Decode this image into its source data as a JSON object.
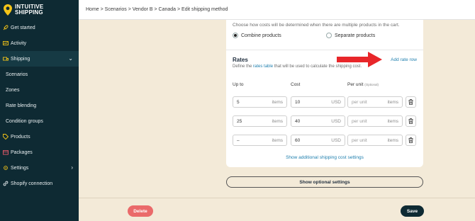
{
  "app": {
    "brand_line1": "INTUITIVE",
    "brand_line2": "SHIPPING"
  },
  "sidebar": {
    "items": [
      {
        "label": "Get started",
        "icon": "rocket-icon"
      },
      {
        "label": "Activity",
        "icon": "activity-icon"
      },
      {
        "label": "Shipping",
        "icon": "shipping-icon"
      },
      {
        "label": "Scenarios"
      },
      {
        "label": "Zones"
      },
      {
        "label": "Rate blending"
      },
      {
        "label": "Condition groups"
      },
      {
        "label": "Products",
        "icon": "tag-icon"
      },
      {
        "label": "Packages",
        "icon": "package-icon"
      },
      {
        "label": "Settings",
        "icon": "gear-icon"
      },
      {
        "label": "Shopify connection",
        "icon": "link-icon"
      }
    ]
  },
  "breadcrumb": {
    "text": "Home > Scenarios > Vendor B > Canada > Edit shipping method"
  },
  "cart_mode": {
    "hint": "Choose how costs will be determined when there are multiple products in the cart.",
    "options": [
      {
        "label": "Combine products",
        "selected": true
      },
      {
        "label": "Separate products",
        "selected": false
      }
    ]
  },
  "rates": {
    "title": "Rates",
    "desc_prefix": "Define the ",
    "desc_link": "rates table",
    "desc_suffix": " that will be used to calculate the shipping cost.",
    "add_label": "Add rate row",
    "columns": {
      "up_to": "Up to",
      "cost": "Cost",
      "per_unit": "Per unit",
      "per_unit_note": "(Optional)"
    },
    "rows": [
      {
        "up_to": "5",
        "up_to_unit": "items",
        "cost": "10",
        "currency": "USD",
        "per_unit_placeholder": "per unit",
        "per_unit_unit": "items"
      },
      {
        "up_to": "25",
        "up_to_unit": "items",
        "cost": "40",
        "currency": "USD",
        "per_unit_placeholder": "per unit",
        "per_unit_unit": "items"
      },
      {
        "up_to": "–",
        "up_to_unit": "items",
        "cost": "60",
        "currency": "USD",
        "per_unit_placeholder": "per unit",
        "per_unit_unit": "items"
      }
    ],
    "show_more": "Show additional shipping cost settings"
  },
  "optional_settings_label": "Show optional settings",
  "actions": {
    "delete": "Delete",
    "save": "Save"
  },
  "colors": {
    "sidebar_bg": "#0e2a33",
    "accent_link": "#1f7fae",
    "delete": "#ea6a6a",
    "annotation_arrow": "#e8262a",
    "page_bg": "#f3ead8"
  }
}
